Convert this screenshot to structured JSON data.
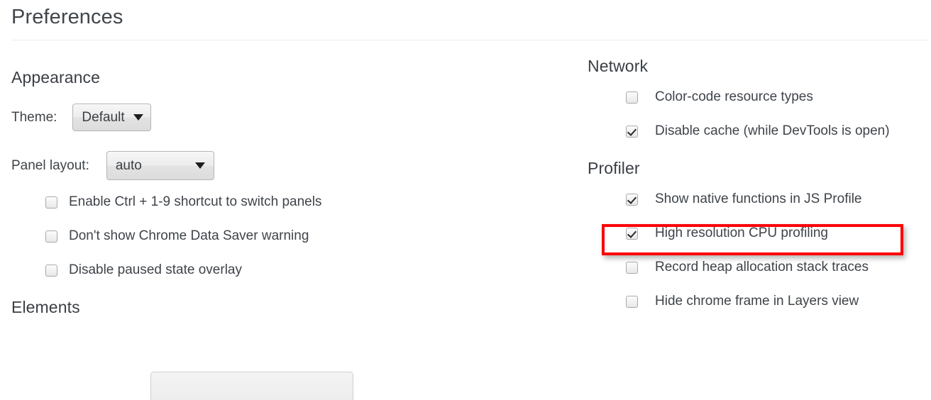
{
  "page": {
    "title": "Preferences"
  },
  "appearance": {
    "heading": "Appearance",
    "theme": {
      "label": "Theme:",
      "value": "Default",
      "caret_icon": "chevron-down-icon"
    },
    "panel_layout": {
      "label": "Panel layout:",
      "value": "auto",
      "caret_icon": "chevron-down-icon"
    },
    "checkboxes": [
      {
        "label": "Enable Ctrl + 1-9 shortcut to switch panels",
        "checked": false
      },
      {
        "label": "Don't show Chrome Data Saver warning",
        "checked": false
      },
      {
        "label": "Disable paused state overlay",
        "checked": false
      }
    ]
  },
  "elements": {
    "heading": "Elements"
  },
  "network": {
    "heading": "Network",
    "checkboxes": [
      {
        "label": "Color-code resource types",
        "checked": false
      },
      {
        "label": "Disable cache (while DevTools is open)",
        "checked": true
      }
    ]
  },
  "profiler": {
    "heading": "Profiler",
    "checkboxes": [
      {
        "label": "Show native functions in JS Profile",
        "checked": true,
        "highlighted": true
      },
      {
        "label": "High resolution CPU profiling",
        "checked": true
      },
      {
        "label": "Record heap allocation stack traces",
        "checked": false
      },
      {
        "label": "Hide chrome frame in Layers view",
        "checked": false
      }
    ]
  },
  "colors": {
    "highlight": "#fb0007",
    "heading_text": "#3a3f45",
    "body_text": "#3f444a",
    "divider": "#ececec",
    "control_border": "#b4b4b4"
  }
}
